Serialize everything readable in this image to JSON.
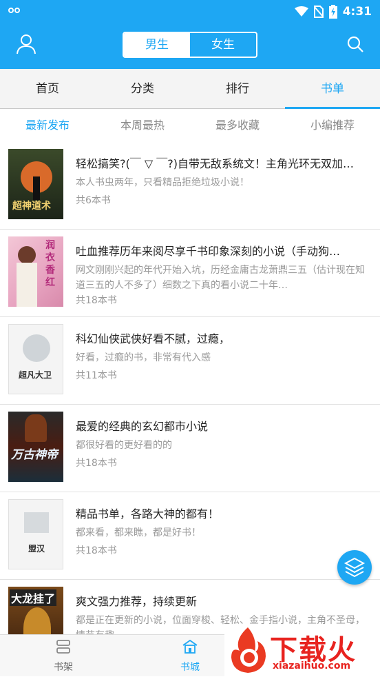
{
  "status_bar": {
    "time": "4:31"
  },
  "header": {
    "gender_tabs": [
      "男生",
      "女生"
    ],
    "active_gender": "男生"
  },
  "main_tabs": [
    "首页",
    "分类",
    "排行",
    "书单"
  ],
  "sub_tabs": [
    "最新发布",
    "本周最热",
    "最多收藏",
    "小编推荐"
  ],
  "book_lists": [
    {
      "title": "轻松搞笑?(￣ ▽ ￣?)自带无敌系统文！主角光环无双加…",
      "desc": "本人书虫两年，只看精品拒绝垃圾小说！",
      "count": "共6本书",
      "cover_text": "超神道术"
    },
    {
      "title": "吐血推荐历年来阅尽享千书印象深刻的小说（手动狗…",
      "desc": "网文刚刚兴起的年代开始入坑，历经金庸古龙萧鼎三五（估计现在知道三五的人不多了）细数之下真的看小说二十年…",
      "count": "共18本书",
      "cover_text": "润衣香红"
    },
    {
      "title": "科幻仙侠武侠好看不腻，过瘾，",
      "desc": "好看，过瘾的书，非常有代入感",
      "count": "共11本书",
      "cover_text": "超凡大卫"
    },
    {
      "title": "最爱的经典的玄幻都市小说",
      "desc": "都很好看的更好看的的",
      "count": "共18本书",
      "cover_text": "万古神帝"
    },
    {
      "title": "精品书单，各路大神的都有！",
      "desc": "都来看，都来瞧，都是好书！",
      "count": "共18本书",
      "cover_text": "盟汉"
    },
    {
      "title": "爽文强力推荐，持续更新",
      "desc": "都是正在更新的小说，位面穿梭、轻松、金手指小说，主角不圣母，情节有趣",
      "count": "",
      "cover_text": "大龙挂了"
    }
  ],
  "bottom_nav": [
    "书架",
    "书城"
  ],
  "watermark": {
    "brand": "下载火",
    "url": "xiazaihuo.com"
  }
}
